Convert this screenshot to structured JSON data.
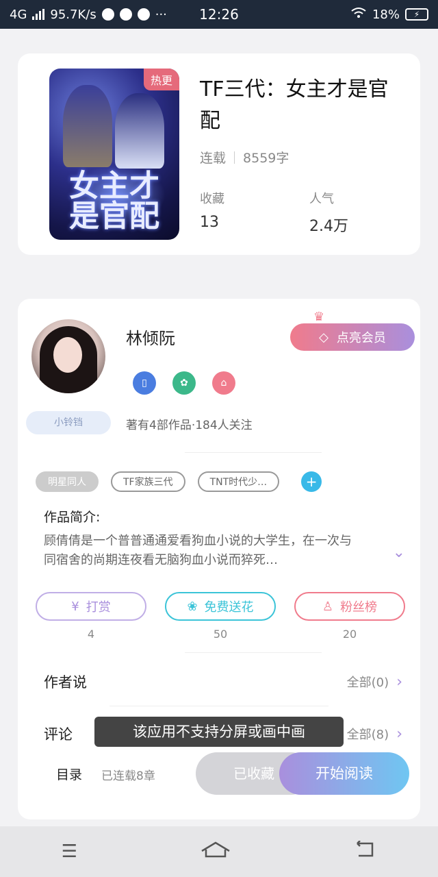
{
  "status_bar": {
    "network": "4G",
    "speed": "95.7K/s",
    "time": "12:26",
    "battery": "18%"
  },
  "book": {
    "badge": "热更",
    "title": "TF三代：女主才是官配",
    "cover_title": "女主才是官配",
    "status": "连载",
    "word_count": "8559字",
    "stats": [
      {
        "label": "收藏",
        "value": "13"
      },
      {
        "label": "人气",
        "value": "2.4万"
      }
    ]
  },
  "author": {
    "name": "林倾阮",
    "nickname_badge": "小铃铛",
    "member_button": "点亮会员",
    "summary": "著有4部作品·184人关注"
  },
  "tags": [
    "明星同人",
    "TF家族三代",
    "TNT时代少…"
  ],
  "intro": {
    "label": "作品简介:",
    "text": "顾倩倩是一个普普通通爱看狗血小说的大学生，在一次与同宿舍的尚期连夜看无脑狗血小说而猝死…"
  },
  "actions": [
    {
      "label": "打赏",
      "count": "4",
      "color": "#a98fdd",
      "icon": "yen-icon"
    },
    {
      "label": "免费送花",
      "count": "50",
      "color": "#3cc4d8",
      "icon": "flower-icon"
    },
    {
      "label": "粉丝榜",
      "count": "20",
      "color": "#f07b8c",
      "icon": "person-icon"
    }
  ],
  "sections": [
    {
      "title": "作者说",
      "more": "全部(0)"
    },
    {
      "title": "评论",
      "more": "全部(8)"
    }
  ],
  "toast": "该应用不支持分屏或画中画",
  "bottom_bar": {
    "catalog": "目录",
    "chapters": "已连载8章",
    "collect": "已收藏",
    "read": "开始阅读"
  }
}
